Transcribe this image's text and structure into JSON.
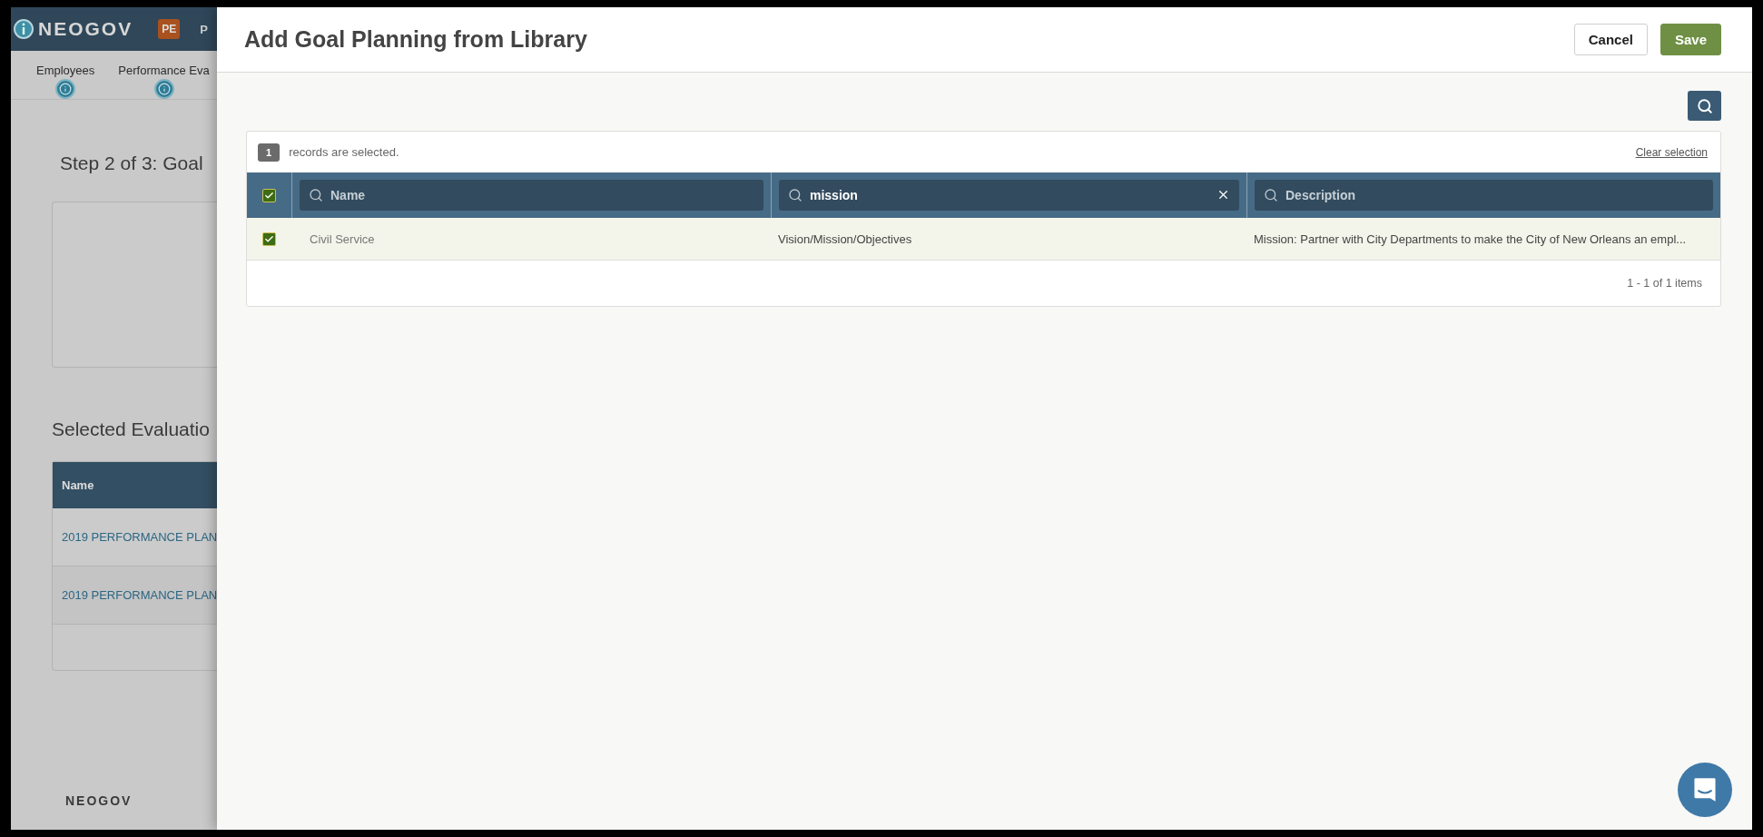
{
  "app": {
    "logo": "NEOGOV",
    "badge": "PE",
    "nav_item": "P"
  },
  "steps": [
    {
      "label": "Employees"
    },
    {
      "label": "Performance Eva"
    }
  ],
  "step_title": "Step 2 of 3: Goal",
  "selected_section": {
    "title": "Selected Evaluatio",
    "columns": [
      "Name"
    ],
    "rows": [
      "2019 PERFORMANCE PLAN",
      "2019 PERFORMANCE PLAN"
    ]
  },
  "footer_logo": "NEOGOV",
  "modal": {
    "title": "Add Goal Planning from Library",
    "buttons": [
      {
        "label": "Cancel",
        "kind": "secondary"
      },
      {
        "label": "Save",
        "kind": "primary"
      }
    ],
    "selection": {
      "count": "1",
      "message": "records are selected.",
      "clear": "Clear selection"
    },
    "select_all_checked": true,
    "filters": [
      {
        "placeholder": "Name"
      },
      {
        "value": "mission"
      },
      {
        "placeholder": "Description"
      }
    ],
    "rows": [
      {
        "checked": true,
        "selected": true,
        "cells": [
          "Civil Service",
          "Vision/Mission/Objectives",
          "Mission: Partner with City Departments to make the City of New Orleans an empl..."
        ]
      }
    ],
    "pager": "1 - 1 of 1 items"
  }
}
